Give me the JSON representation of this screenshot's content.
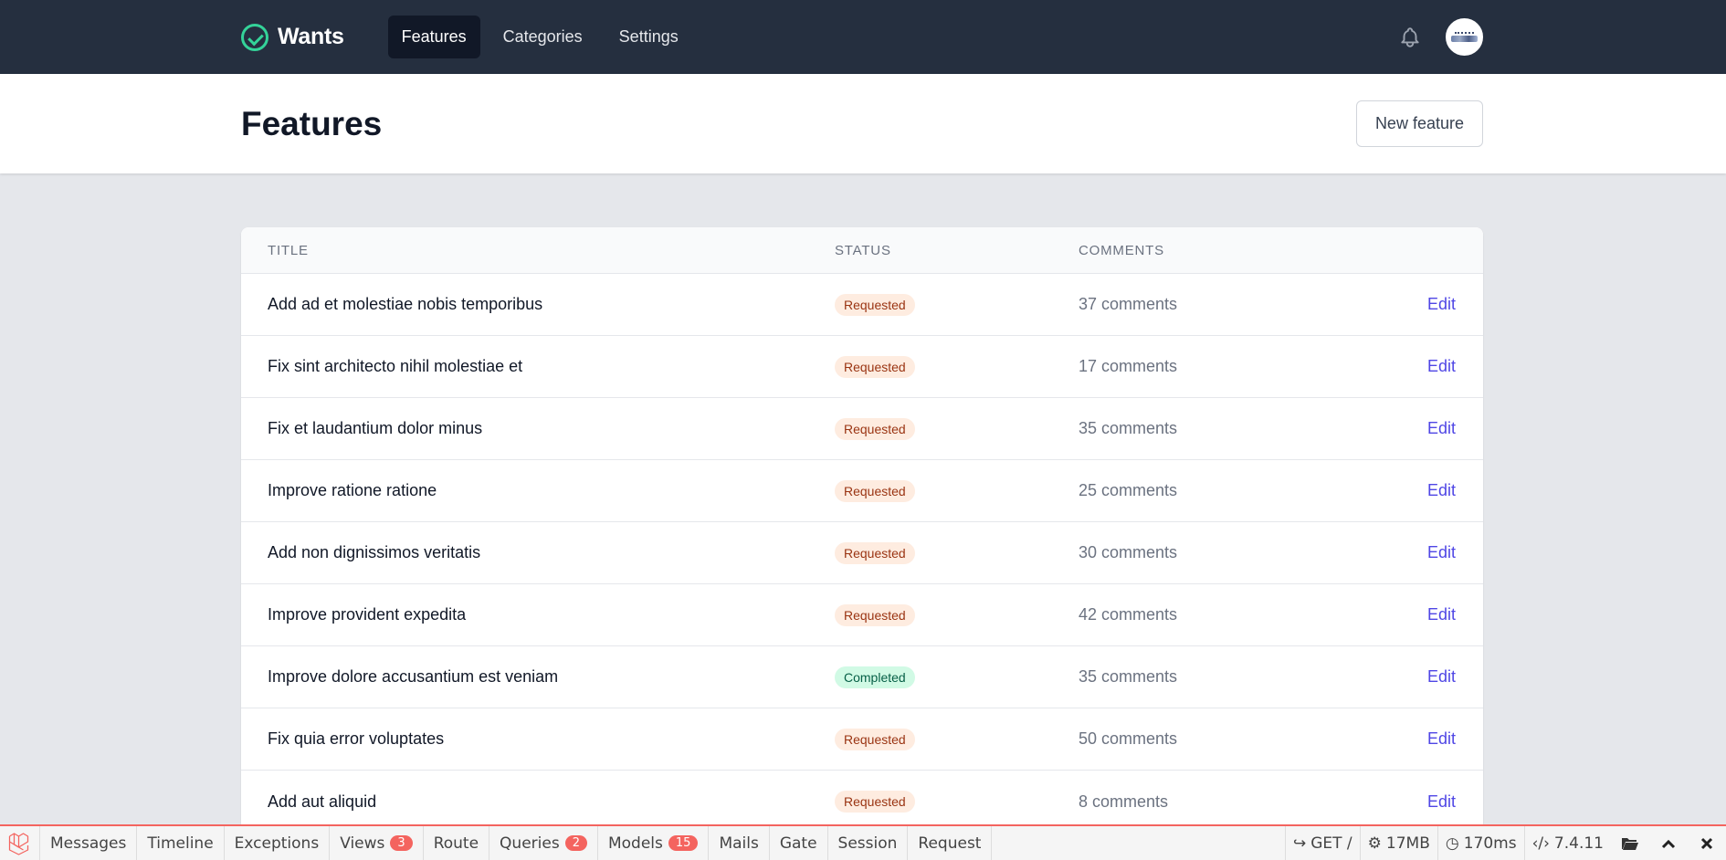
{
  "app": {
    "name": "Wants"
  },
  "nav": {
    "links": [
      {
        "label": "Features",
        "active": true
      },
      {
        "label": "Categories",
        "active": false
      },
      {
        "label": "Settings",
        "active": false
      }
    ]
  },
  "header": {
    "title": "Features",
    "new_button": "New feature"
  },
  "table": {
    "columns": [
      "TITLE",
      "STATUS",
      "COMMENTS"
    ],
    "rows": [
      {
        "title": "Add ad et molestiae nobis temporibus",
        "status": "Requested",
        "comments": "37 comments",
        "action": "Edit"
      },
      {
        "title": "Fix sint architecto nihil molestiae et",
        "status": "Requested",
        "comments": "17 comments",
        "action": "Edit"
      },
      {
        "title": "Fix et laudantium dolor minus",
        "status": "Requested",
        "comments": "35 comments",
        "action": "Edit"
      },
      {
        "title": "Improve ratione ratione",
        "status": "Requested",
        "comments": "25 comments",
        "action": "Edit"
      },
      {
        "title": "Add non dignissimos veritatis",
        "status": "Requested",
        "comments": "30 comments",
        "action": "Edit"
      },
      {
        "title": "Improve provident expedita",
        "status": "Requested",
        "comments": "42 comments",
        "action": "Edit"
      },
      {
        "title": "Improve dolore accusantium est veniam",
        "status": "Completed",
        "comments": "35 comments",
        "action": "Edit"
      },
      {
        "title": "Fix quia error voluptates",
        "status": "Requested",
        "comments": "50 comments",
        "action": "Edit"
      },
      {
        "title": "Add aut aliquid",
        "status": "Requested",
        "comments": "8 comments",
        "action": "Edit"
      }
    ]
  },
  "debugbar": {
    "tabs": [
      {
        "label": "Messages",
        "count": ""
      },
      {
        "label": "Timeline",
        "count": ""
      },
      {
        "label": "Exceptions",
        "count": ""
      },
      {
        "label": "Views",
        "count": "3"
      },
      {
        "label": "Route",
        "count": ""
      },
      {
        "label": "Queries",
        "count": "2"
      },
      {
        "label": "Models",
        "count": "15"
      },
      {
        "label": "Mails",
        "count": ""
      },
      {
        "label": "Gate",
        "count": ""
      },
      {
        "label": "Session",
        "count": ""
      },
      {
        "label": "Request",
        "count": ""
      }
    ],
    "method": "GET /",
    "memory": "17MB",
    "time": "170ms",
    "version": "7.4.11"
  },
  "colors": {
    "nav_bg": "#252f3f",
    "brand_accent": "#34d399",
    "link_accent": "#4f46e5",
    "debug_accent": "#f4645f"
  }
}
